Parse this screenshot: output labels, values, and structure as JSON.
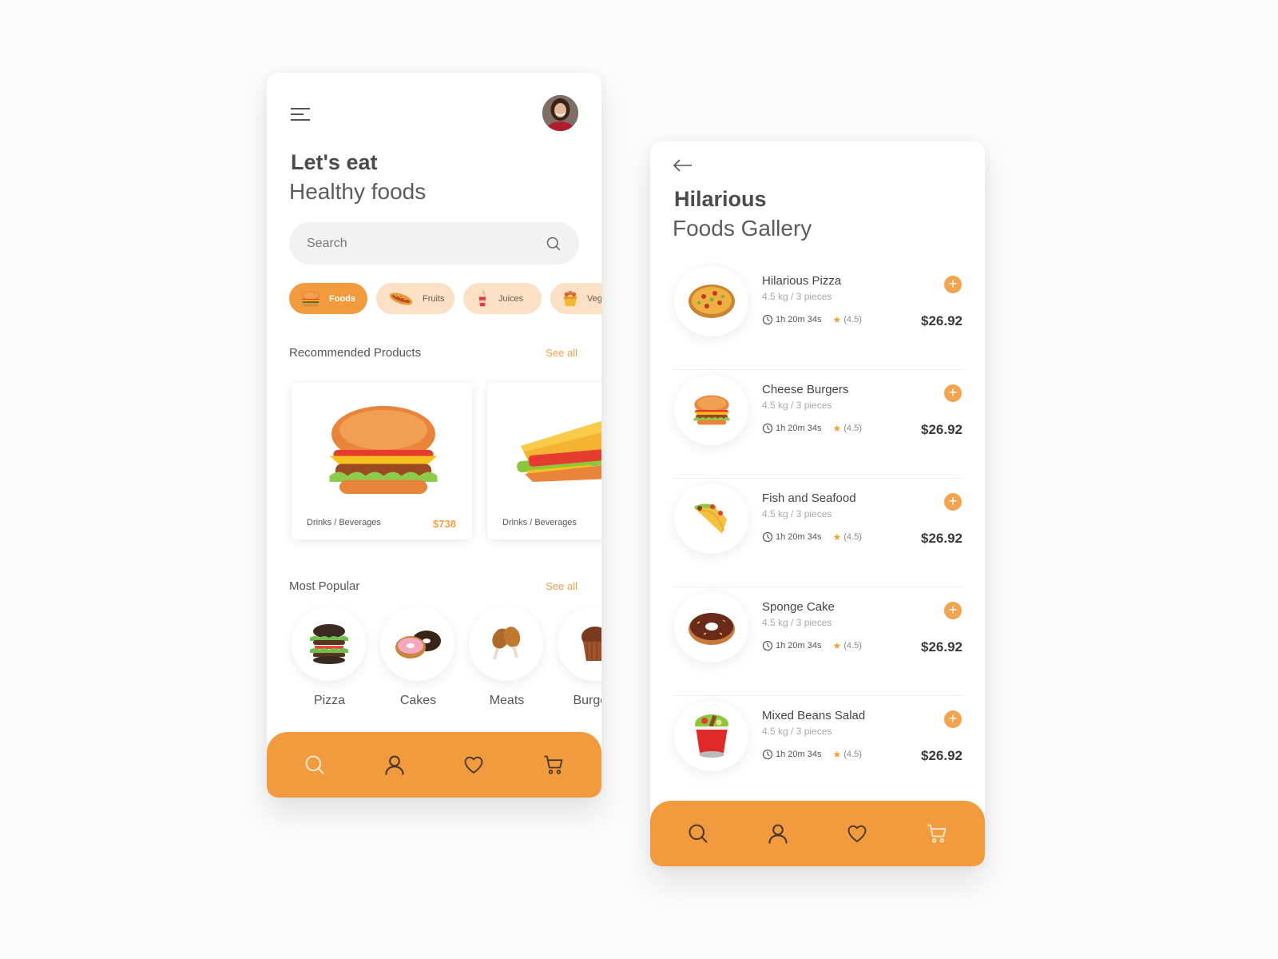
{
  "home": {
    "title_bold": "Let's eat",
    "title_light": "Healthy foods",
    "search": {
      "placeholder": "Search"
    },
    "categories": [
      {
        "label": "Foods",
        "icon": "burger-icon",
        "active": true
      },
      {
        "label": "Fruits",
        "icon": "hotdog-icon",
        "active": false
      },
      {
        "label": "Juices",
        "icon": "soda-cup-icon",
        "active": false
      },
      {
        "label": "Vegetables",
        "icon": "fries-bucket-icon",
        "active": false
      }
    ],
    "recommended": {
      "title": "Recommended Products",
      "see_all": "See all",
      "products": [
        {
          "category": "Drinks / Beverages",
          "price": "$738",
          "image": "burger"
        },
        {
          "category": "Drinks / Beverages",
          "price": "",
          "image": "sandwich"
        }
      ]
    },
    "popular": {
      "title": "Most Popular",
      "see_all": "See all",
      "items": [
        {
          "label": "Pizza",
          "image": "double-burger"
        },
        {
          "label": "Cakes",
          "image": "donuts"
        },
        {
          "label": "Meats",
          "image": "chicken-legs"
        },
        {
          "label": "Burgers",
          "image": "muffin"
        }
      ]
    },
    "nav": {
      "active": "search",
      "items": [
        "search",
        "profile",
        "favorites",
        "cart"
      ]
    }
  },
  "gallery": {
    "title_bold": "Hilarious",
    "title_light": "Foods Gallery",
    "items": [
      {
        "name": "Hilarious Pizza",
        "weight": "4.5 kg / 3 pieces",
        "time": "1h 20m 34s",
        "rating": "(4.5)",
        "price": "$26.92",
        "image": "pizza"
      },
      {
        "name": "Cheese Burgers",
        "weight": "4.5 kg / 3 pieces",
        "time": "1h 20m 34s",
        "rating": "(4.5)",
        "price": "$26.92",
        "image": "burger"
      },
      {
        "name": "Fish and Seafood",
        "weight": "4.5 kg / 3 pieces",
        "time": "1h 20m 34s",
        "rating": "(4.5)",
        "price": "$26.92",
        "image": "taco"
      },
      {
        "name": "Sponge Cake",
        "weight": "4.5 kg / 3 pieces",
        "time": "1h 20m 34s",
        "rating": "(4.5)",
        "price": "$26.92",
        "image": "donut"
      },
      {
        "name": "Mixed Beans Salad",
        "weight": "4.5 kg / 3 pieces",
        "time": "1h 20m 34s",
        "rating": "(4.5)",
        "price": "$26.92",
        "image": "salad"
      }
    ],
    "nav": {
      "active": "cart",
      "items": [
        "search",
        "profile",
        "favorites",
        "cart"
      ]
    }
  },
  "colors": {
    "accent": "#f19a3e",
    "chip_bg": "#fbe0c6",
    "nav_icon": "#4a3a2a",
    "nav_icon_active": "#fde9cf"
  }
}
